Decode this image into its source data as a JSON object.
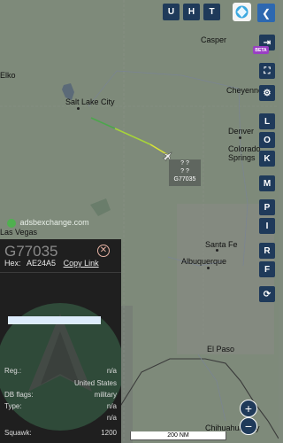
{
  "map": {
    "cities": [
      {
        "name": "Casper"
      },
      {
        "name": "Cheyenne"
      },
      {
        "name": "Salt Lake City"
      },
      {
        "name": "Denver"
      },
      {
        "name": "Colorado Springs"
      },
      {
        "name": "Las Vegas"
      },
      {
        "name": "Santa Fe"
      },
      {
        "name": "Albuquerque"
      },
      {
        "name": "El Paso"
      },
      {
        "name": "Chihuahua City"
      },
      {
        "name": "Elko"
      }
    ],
    "watermark": "adsbexchange.com",
    "scale_label": "200 NM"
  },
  "top_buttons": [
    "U",
    "H",
    "T"
  ],
  "side_buttons": {
    "beta": "BETA",
    "letters": [
      "L",
      "O",
      "K",
      "M",
      "P",
      "I",
      "R",
      "F"
    ]
  },
  "aircraft_label": {
    "line1": "? ?",
    "line2": "? ?",
    "callsign": "G77035"
  },
  "panel": {
    "callsign": "G77035",
    "hex_label": "Hex:",
    "hex_value": "AE24A5",
    "copy_link": "Copy Link",
    "rows": [
      {
        "k": "Reg.:",
        "v": "n/a"
      },
      {
        "k": "",
        "v": "United States"
      },
      {
        "k": "DB flags:",
        "v": "military"
      },
      {
        "k": "Type:",
        "v": "n/a"
      },
      {
        "k": "",
        "v": "n/a"
      },
      {
        "k": "Squawk:",
        "v": "1200"
      }
    ]
  },
  "zoom": {
    "in": "+",
    "out": "−"
  }
}
